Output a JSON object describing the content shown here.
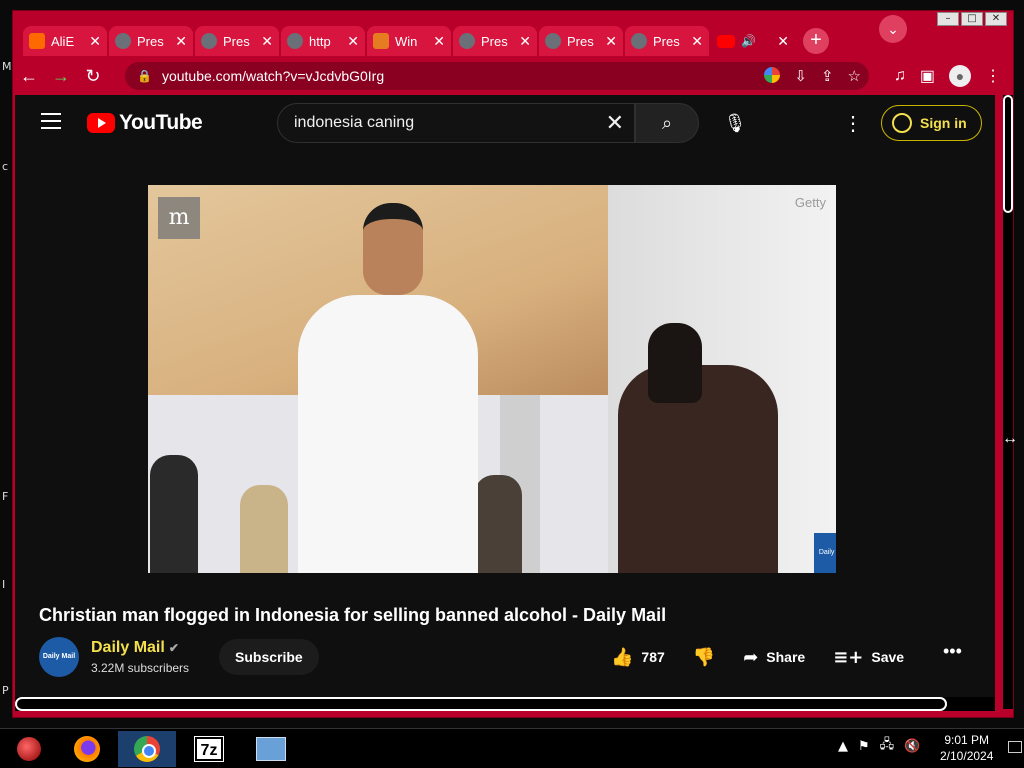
{
  "window": {
    "controls": [
      "–",
      "□",
      "✕"
    ]
  },
  "tabs": [
    {
      "title": "AliE",
      "icon": "aliexpress-icon"
    },
    {
      "title": "Pres",
      "icon": "globe-icon"
    },
    {
      "title": "Pres",
      "icon": "globe-icon"
    },
    {
      "title": "http",
      "icon": "globe-icon"
    },
    {
      "title": "Win",
      "icon": "windows-icon"
    },
    {
      "title": "Pres",
      "icon": "globe-icon"
    },
    {
      "title": "Pres",
      "icon": "globe-icon"
    },
    {
      "title": "Pres",
      "icon": "globe-icon"
    },
    {
      "title": "",
      "icon": "youtube-icon",
      "active": true,
      "audio": true
    }
  ],
  "toolbar": {
    "url": "youtube.com/watch?v=vJcdvbG0Irg"
  },
  "youtube": {
    "logo_text": "YouTube",
    "search_value": "indonesia caning",
    "sign_in_label": "Sign in",
    "video": {
      "watermark_text": "Getty",
      "logo_letter": "m",
      "badge_text": "Daily Mail"
    },
    "title": "Christian man flogged in Indonesia for selling banned alcohol - Daily Mail",
    "channel": {
      "name": "Daily Mail",
      "avatar_text": "Daily Mail",
      "subscribers": "3.22M subscribers",
      "subscribe_label": "Subscribe"
    },
    "actions": {
      "likes": "787",
      "share_label": "Share",
      "save_label": "Save"
    }
  },
  "taskbar": {
    "time": "9:01 PM",
    "date": "2/10/2024"
  },
  "colors": {
    "browser_frame": "#b8002a",
    "yt_background": "#0f0f0f",
    "yt_red": "#ff0000",
    "channel_name": "#f4e04d"
  }
}
